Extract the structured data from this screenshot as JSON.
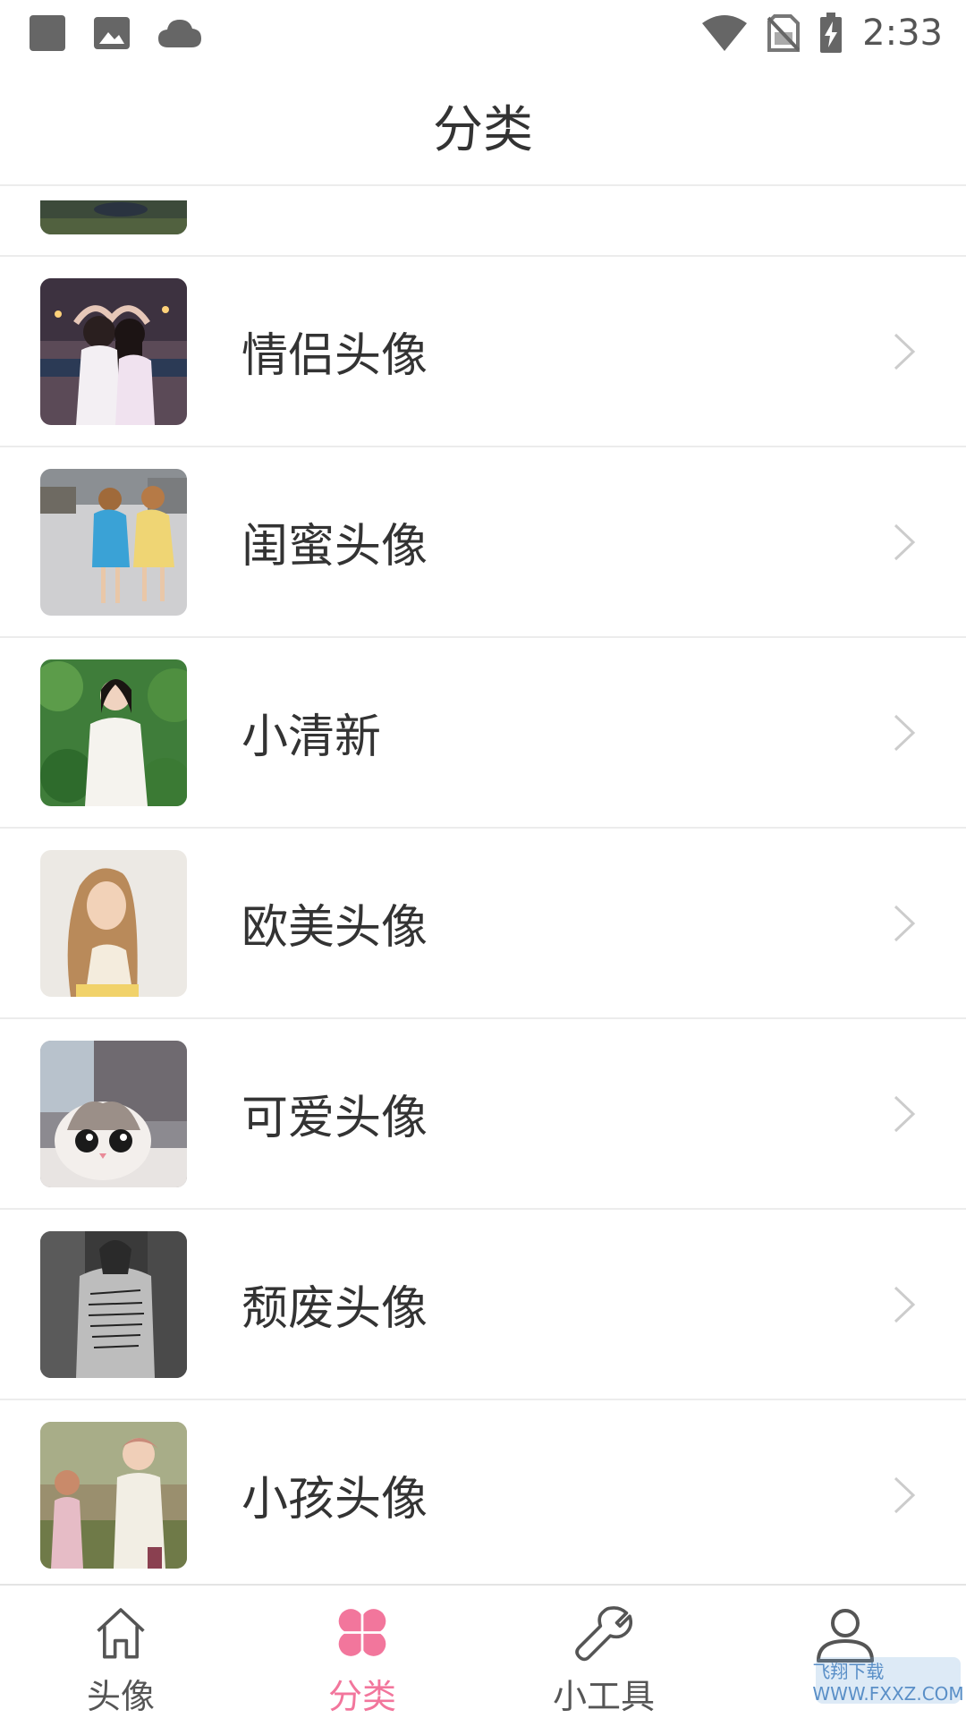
{
  "status_bar": {
    "time": "2:33",
    "icons": [
      "app-square-icon",
      "gallery-icon",
      "cloud-icon",
      "wifi-icon",
      "no-sim-icon",
      "battery-charging-icon"
    ]
  },
  "header": {
    "title": "分类"
  },
  "categories": [
    {
      "label": "情侣头像",
      "thumb_icon": "couple-photo"
    },
    {
      "label": "闺蜜头像",
      "thumb_icon": "girlfriends-photo"
    },
    {
      "label": "小清新",
      "thumb_icon": "fresh-girl-photo"
    },
    {
      "label": "欧美头像",
      "thumb_icon": "western-girl-photo"
    },
    {
      "label": "可爱头像",
      "thumb_icon": "cute-cat-photo"
    },
    {
      "label": "颓废头像",
      "thumb_icon": "decadent-photo"
    },
    {
      "label": "小孩头像",
      "thumb_icon": "kids-photo"
    }
  ],
  "bottom_nav": {
    "items": [
      {
        "label": "头像",
        "icon": "home-icon",
        "active": false
      },
      {
        "label": "分类",
        "icon": "clover-icon",
        "active": true
      },
      {
        "label": "小工具",
        "icon": "wrench-icon",
        "active": false
      },
      {
        "label": "",
        "icon": "user-icon",
        "active": false
      }
    ]
  },
  "watermark": {
    "text": "飞翔下载 WWW.FXXZ.COM"
  },
  "colors": {
    "accent": "#f2769c",
    "text": "#333333",
    "divider": "#ececec",
    "icon": "#555555"
  }
}
